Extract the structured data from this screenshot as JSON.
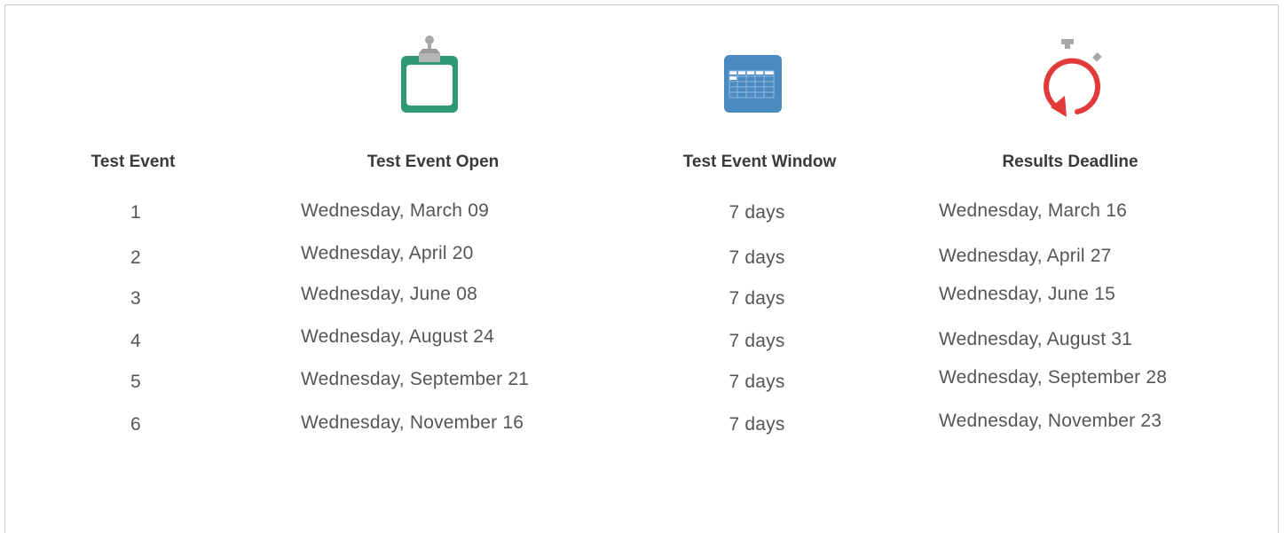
{
  "icons": {
    "open": "clipboard-icon",
    "window": "calendar-grid-icon",
    "deadline": "stopwatch-refresh-icon"
  },
  "colors": {
    "clipboard": "#2e9a73",
    "calendar": "#4b8ac0",
    "stopwatch": "#e23a3a",
    "clip_gray": "#a8a8a8"
  },
  "table": {
    "headers": {
      "event": "Test Event",
      "open": "Test Event Open",
      "window": "Test Event Window",
      "deadline": "Results Deadline"
    },
    "rows": [
      {
        "event": "1",
        "open": "Wednesday, March 09",
        "window": "7 days",
        "deadline": "Wednesday, March 16"
      },
      {
        "event": "2",
        "open": "Wednesday, April 20",
        "window": "7 days",
        "deadline": "Wednesday, April 27"
      },
      {
        "event": "3",
        "open": "Wednesday, June 08",
        "window": "7 days",
        "deadline": "Wednesday, June 15"
      },
      {
        "event": "4",
        "open": "Wednesday, August 24",
        "window": "7 days",
        "deadline": "Wednesday, August 31"
      },
      {
        "event": "5",
        "open": "Wednesday, September 21",
        "window": "7 days",
        "deadline": "Wednesday, September 28"
      },
      {
        "event": "6",
        "open": "Wednesday, November 16",
        "window": "7 days",
        "deadline": "Wednesday, November 23"
      }
    ]
  }
}
